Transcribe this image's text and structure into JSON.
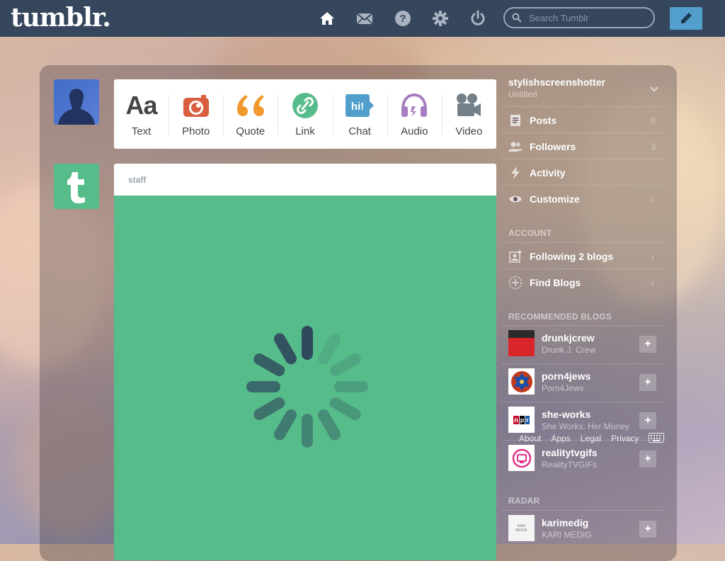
{
  "header": {
    "logo": "tumblr.",
    "search_placeholder": "Search Tumblr",
    "icons": [
      "home-icon",
      "mail-icon",
      "help-icon",
      "gear-icon",
      "power-icon",
      "compose-icon"
    ]
  },
  "post_types": [
    {
      "label": "Text",
      "icon": "text-icon",
      "color": "#444444"
    },
    {
      "label": "Photo",
      "icon": "camera-icon",
      "color": "#d95e40"
    },
    {
      "label": "Quote",
      "icon": "quote-icon",
      "color": "#f2992e"
    },
    {
      "label": "Link",
      "icon": "link-icon",
      "color": "#56bc8a"
    },
    {
      "label": "Chat",
      "icon": "chat-icon",
      "color": "#529ecc"
    },
    {
      "label": "Audio",
      "icon": "headphones-icon",
      "color": "#a77dc2"
    },
    {
      "label": "Video",
      "icon": "video-camera-icon",
      "color": "#748089"
    }
  ],
  "post": {
    "author": "staff",
    "background": "#56bc8a"
  },
  "sidebar": {
    "blog_name": "stylishscreenshotter",
    "blog_title": "Untitled",
    "items": [
      {
        "label": "Posts",
        "count": "0"
      },
      {
        "label": "Followers",
        "count": "3"
      },
      {
        "label": "Activity",
        "count": ""
      },
      {
        "label": "Customize",
        "count": ""
      }
    ],
    "account_title": "ACCOUNT",
    "account_items": [
      {
        "label": "Following 2 blogs"
      },
      {
        "label": "Find Blogs"
      }
    ],
    "recommended_title": "RECOMMENDED BLOGS",
    "recommended": [
      {
        "name": "drunkjcrew",
        "title": "Drunk J. Crew"
      },
      {
        "name": "porn4jews",
        "title": "Porn4Jews"
      },
      {
        "name": "she-works",
        "title": "She Works: Her Money"
      },
      {
        "name": "realitytvgifs",
        "title": "RealityTVGIFs"
      }
    ],
    "radar_title": "RADAR",
    "radar": {
      "name": "karimedig",
      "title": "KARI MEDIG"
    }
  },
  "footer": {
    "about": "About",
    "apps": "Apps",
    "legal": "Legal",
    "privacy": "Privacy"
  }
}
